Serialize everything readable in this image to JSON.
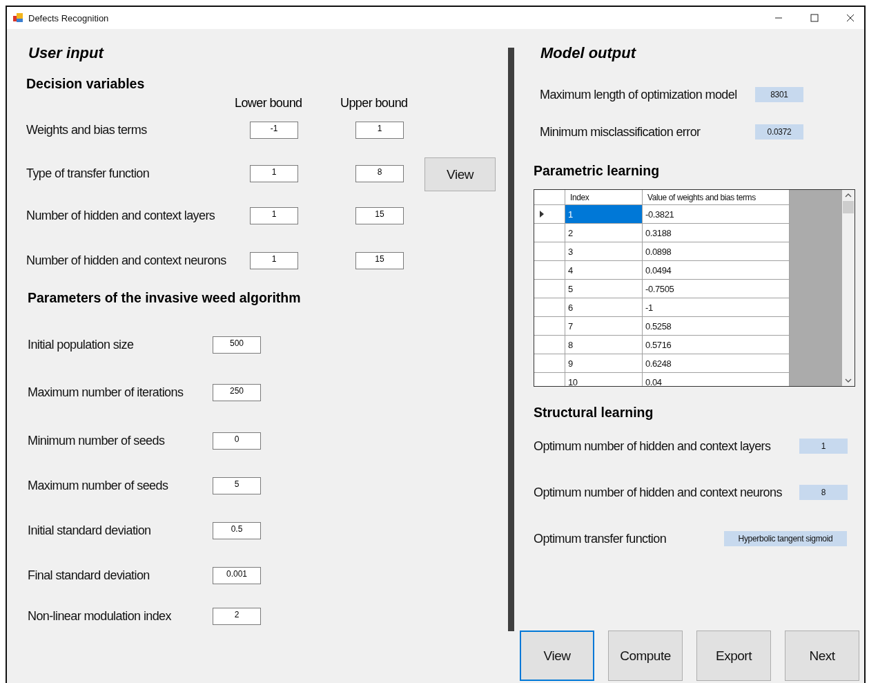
{
  "window": {
    "title": "Defects Recognition"
  },
  "user_input": {
    "title": "User input",
    "decision_variables": {
      "title": "Decision variables",
      "columns": [
        "Lower bound",
        "Upper bound"
      ],
      "rows": [
        {
          "label": "Weights and bias terms",
          "lower": "-1",
          "upper": "1"
        },
        {
          "label": "Type of transfer function",
          "lower": "1",
          "upper": "8"
        },
        {
          "label": "Number of hidden and context layers",
          "lower": "1",
          "upper": "15"
        },
        {
          "label": "Number of hidden and context neurons",
          "lower": "1",
          "upper": "15"
        }
      ],
      "view_button": "View"
    },
    "parameters": {
      "title": "Parameters of the invasive weed algorithm",
      "rows": [
        {
          "label": "Initial population size",
          "value": "500"
        },
        {
          "label": "Maximum number of iterations",
          "value": "250"
        },
        {
          "label": "Minimum number of seeds",
          "value": "0"
        },
        {
          "label": "Maximum  number of seeds",
          "value": "5"
        },
        {
          "label": "Initial standard deviation",
          "value": "0.5"
        },
        {
          "label": "Final standard deviation",
          "value": "0.001"
        },
        {
          "label": "Non-linear modulation index",
          "value": "2"
        }
      ]
    }
  },
  "model_output": {
    "title": "Model output",
    "results": [
      {
        "label": "Maximum length of optimization model",
        "value": "8301"
      },
      {
        "label": "Minimum misclassification error",
        "value": "0.0372"
      }
    ],
    "parametric_learning": {
      "title": "Parametric learning",
      "columns": [
        "Index",
        "Value of weights and bias terms"
      ],
      "rows": [
        {
          "index": "1",
          "value": "-0.3821",
          "selected": true
        },
        {
          "index": "2",
          "value": "0.3188",
          "selected": false
        },
        {
          "index": "3",
          "value": "0.0898",
          "selected": false
        },
        {
          "index": "4",
          "value": "0.0494",
          "selected": false
        },
        {
          "index": "5",
          "value": "-0.7505",
          "selected": false
        },
        {
          "index": "6",
          "value": "-1",
          "selected": false
        },
        {
          "index": "7",
          "value": "0.5258",
          "selected": false
        },
        {
          "index": "8",
          "value": "0.5716",
          "selected": false
        },
        {
          "index": "9",
          "value": "0.6248",
          "selected": false
        },
        {
          "index": "10",
          "value": "0.04",
          "selected": false
        }
      ]
    },
    "structural_learning": {
      "title": "Structural learning",
      "rows": [
        {
          "label": "Optimum number of hidden and context layers",
          "value": "1"
        },
        {
          "label": "Optimum number of hidden and context neurons",
          "value": "8"
        },
        {
          "label": "Optimum transfer function",
          "value": "Hyperbolic tangent sigmoid"
        }
      ]
    }
  },
  "buttons": [
    {
      "label": "View",
      "focused": true
    },
    {
      "label": "Compute",
      "focused": false
    },
    {
      "label": "Export",
      "focused": false
    },
    {
      "label": "Next",
      "focused": false
    }
  ]
}
